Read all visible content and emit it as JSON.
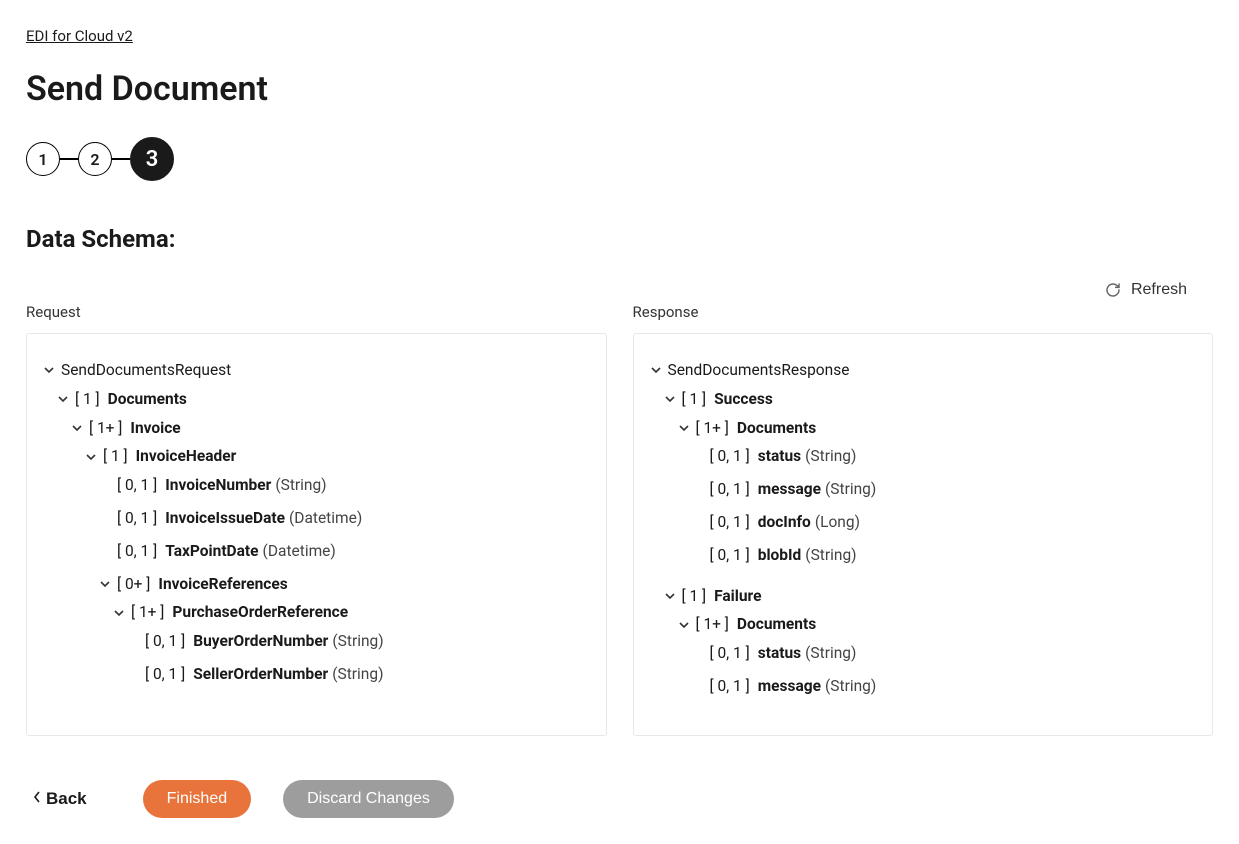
{
  "breadcrumb": {
    "label": "EDI for Cloud v2"
  },
  "page_title": "Send Document",
  "stepper": {
    "steps": [
      "1",
      "2",
      "3"
    ],
    "active_index": 2
  },
  "section_title": "Data Schema:",
  "refresh_label": "Refresh",
  "request_label": "Request",
  "response_label": "Response",
  "request_tree": {
    "name": "SendDocumentsRequest",
    "expandable": true,
    "children": [
      {
        "cardinality": "[ 1 ]",
        "name": "Documents",
        "expandable": true,
        "children": [
          {
            "cardinality": "[ 1+ ]",
            "name": "Invoice",
            "expandable": true,
            "children": [
              {
                "cardinality": "[ 1 ]",
                "name": "InvoiceHeader",
                "expandable": true,
                "children": [
                  {
                    "cardinality": "[ 0, 1 ]",
                    "name": "InvoiceNumber",
                    "type": "(String)"
                  },
                  {
                    "cardinality": "[ 0, 1 ]",
                    "name": "InvoiceIssueDate",
                    "type": "(Datetime)"
                  },
                  {
                    "cardinality": "[ 0, 1 ]",
                    "name": "TaxPointDate",
                    "type": "(Datetime)"
                  },
                  {
                    "cardinality": "[ 0+ ]",
                    "name": "InvoiceReferences",
                    "expandable": true,
                    "children": [
                      {
                        "cardinality": "[ 1+ ]",
                        "name": "PurchaseOrderReference",
                        "expandable": true,
                        "children": [
                          {
                            "cardinality": "[ 0, 1 ]",
                            "name": "BuyerOrderNumber",
                            "type": "(String)"
                          },
                          {
                            "cardinality": "[ 0, 1 ]",
                            "name": "SellerOrderNumber",
                            "type": "(String)"
                          }
                        ]
                      }
                    ]
                  }
                ]
              }
            ]
          }
        ]
      }
    ]
  },
  "response_tree": {
    "name": "SendDocumentsResponse",
    "expandable": true,
    "children": [
      {
        "cardinality": "[ 1 ]",
        "name": "Success",
        "expandable": true,
        "children": [
          {
            "cardinality": "[ 1+ ]",
            "name": "Documents",
            "expandable": true,
            "children": [
              {
                "cardinality": "[ 0, 1 ]",
                "name": "status",
                "type": "(String)"
              },
              {
                "cardinality": "[ 0, 1 ]",
                "name": "message",
                "type": "(String)"
              },
              {
                "cardinality": "[ 0, 1 ]",
                "name": "docInfo",
                "type": "(Long)"
              },
              {
                "cardinality": "[ 0, 1 ]",
                "name": "blobId",
                "type": "(String)"
              }
            ]
          }
        ]
      },
      {
        "cardinality": "[ 1 ]",
        "name": "Failure",
        "expandable": true,
        "children": [
          {
            "cardinality": "[ 1+ ]",
            "name": "Documents",
            "expandable": true,
            "children": [
              {
                "cardinality": "[ 0, 1 ]",
                "name": "status",
                "type": "(String)"
              },
              {
                "cardinality": "[ 0, 1 ]",
                "name": "message",
                "type": "(String)"
              }
            ]
          }
        ]
      }
    ]
  },
  "footer": {
    "back": "Back",
    "finished": "Finished",
    "discard": "Discard Changes"
  }
}
